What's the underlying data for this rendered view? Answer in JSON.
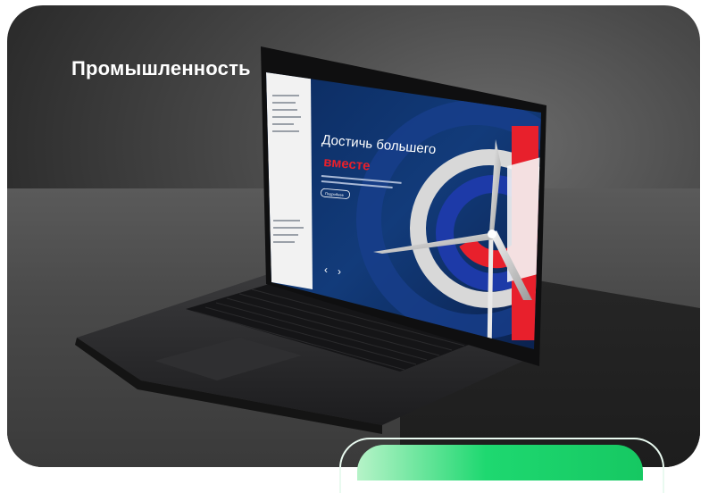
{
  "banner": {
    "title": "Промышленность"
  },
  "screen": {
    "headline_line1": "Достичь большего",
    "headline_line2": "вместе",
    "cta_label": "Подробнее",
    "accent_red": "#e8202c",
    "accent_blue": "#1d3aa8"
  },
  "colors": {
    "card_bg": "#3a3a3a",
    "green": "#1ed870"
  }
}
